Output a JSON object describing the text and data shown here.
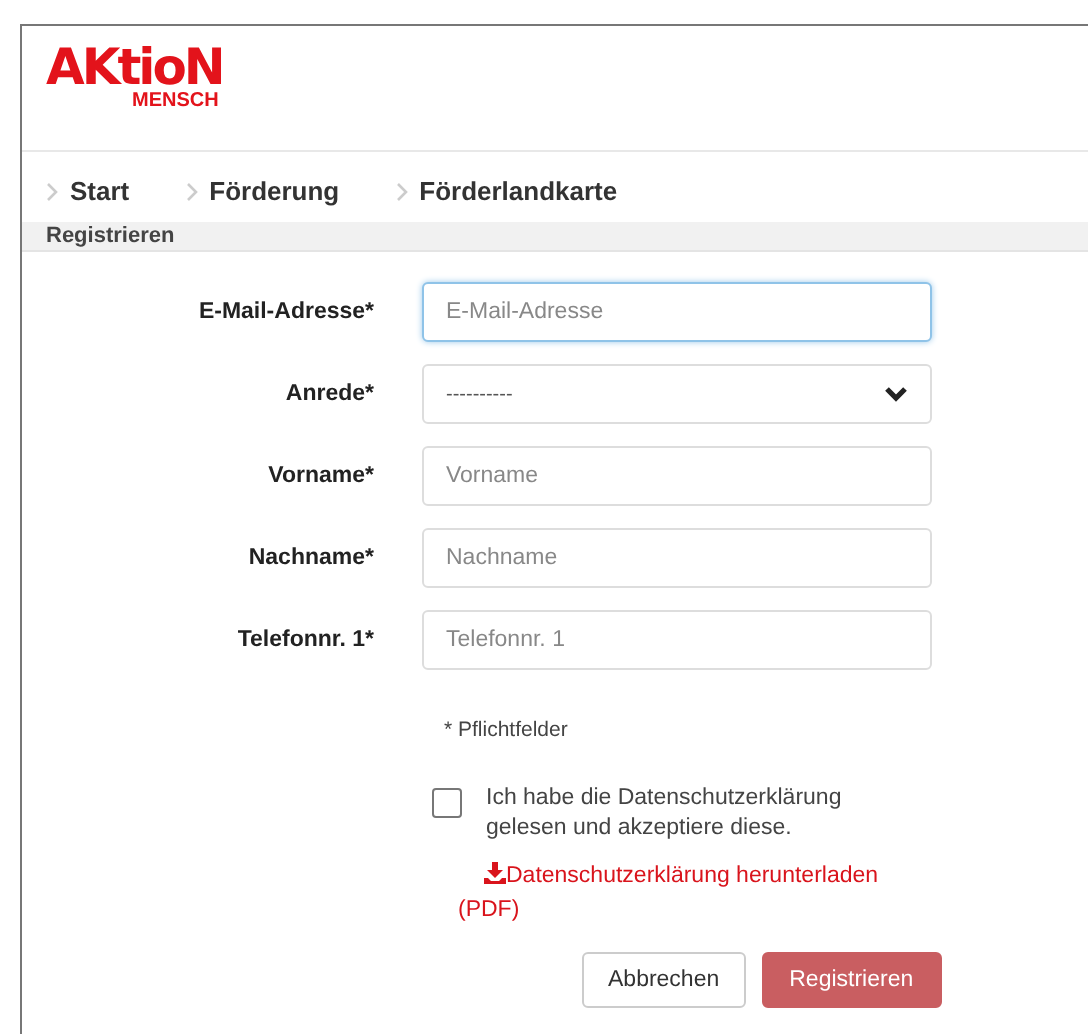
{
  "logo": {
    "line1": "AKtioN",
    "line2": "MENSCH"
  },
  "breadcrumb": [
    {
      "label": "Start"
    },
    {
      "label": "Förderung"
    },
    {
      "label": "Förderlandkarte"
    }
  ],
  "section_title": "Registrieren",
  "fields": [
    {
      "label": "E-Mail-Adresse*",
      "kind": "input",
      "placeholder": "E-Mail-Adresse",
      "focused": true
    },
    {
      "label": "Anrede*",
      "kind": "select",
      "value": "----------",
      "focused": false
    },
    {
      "label": "Vorname*",
      "kind": "input",
      "placeholder": "Vorname",
      "focused": false
    },
    {
      "label": "Nachname*",
      "kind": "input",
      "placeholder": "Nachname",
      "focused": false
    },
    {
      "label": "Telefonnr. 1*",
      "kind": "input",
      "placeholder": "Telefonnr. 1",
      "focused": false
    }
  ],
  "required_note": "* Pflichtfelder",
  "consent": {
    "checked": false,
    "text": "Ich habe die Datenschutzerklärung gelesen und akzeptiere diese.",
    "link": "Datenschutzerklärung herunterladen (PDF)"
  },
  "buttons": [
    {
      "label": "Abbrechen",
      "kind": "secondary"
    },
    {
      "label": "Registrieren",
      "kind": "primary"
    }
  ]
}
